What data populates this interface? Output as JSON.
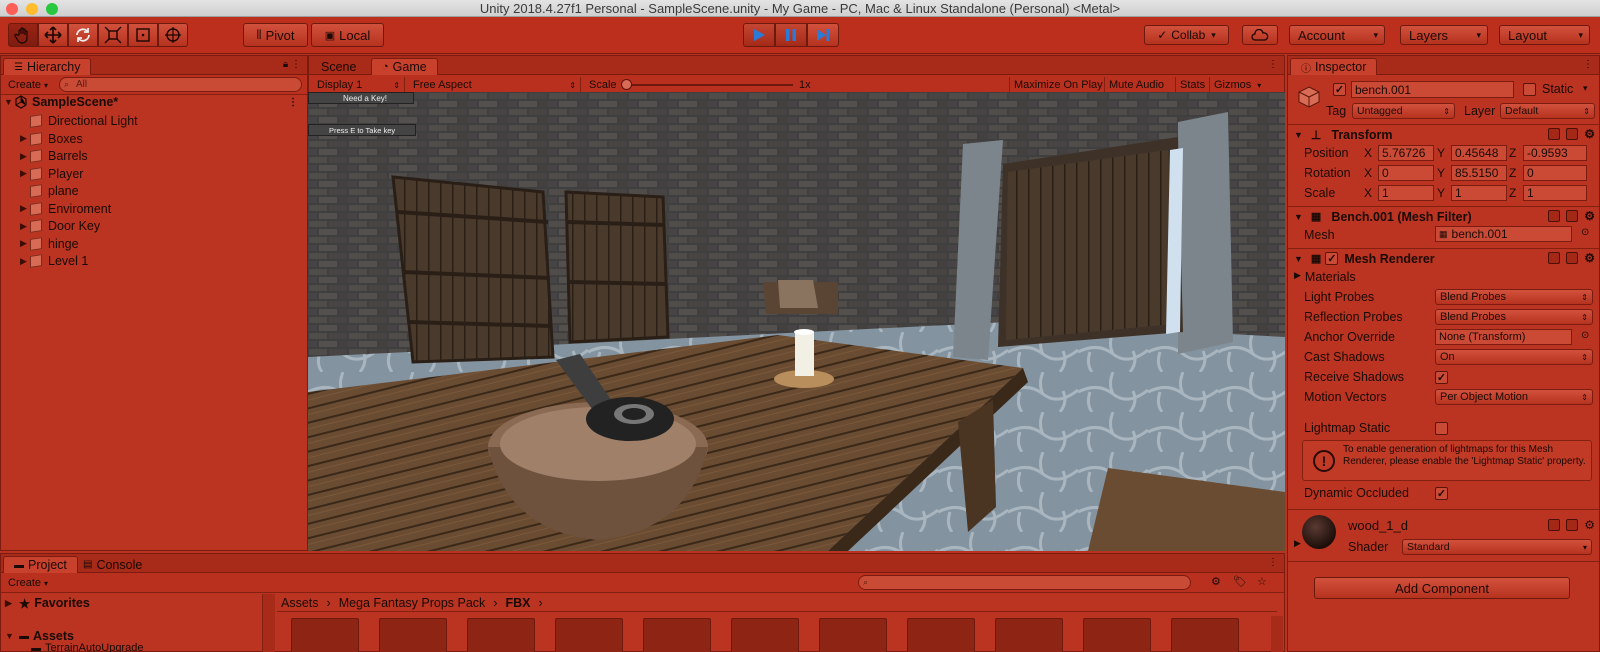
{
  "window": {
    "title": "Unity 2018.4.27f1 Personal - SampleScene.unity - My Game - PC, Mac & Linux Standalone (Personal) <Metal>",
    "traffic_colors": [
      "#ff5f57",
      "#febc2e",
      "#28c840"
    ]
  },
  "toolbar": {
    "tools": [
      "hand-tool-icon",
      "move-tool-icon",
      "rotate-tool-icon",
      "scale-tool-icon",
      "rect-tool-icon",
      "transform-tool-icon"
    ],
    "pivot_label": "Pivot",
    "local_label": "Local",
    "collab_label": "Collab",
    "account_label": "Account",
    "layers_label": "Layers",
    "layout_label": "Layout"
  },
  "hierarchy": {
    "tab_label": "Hierarchy",
    "create_label": "Create",
    "search_placeholder": "All",
    "scene_name": "SampleScene*",
    "items": [
      {
        "label": "Directional Light",
        "has_children": false
      },
      {
        "label": "Boxes",
        "has_children": true
      },
      {
        "label": "Barrels",
        "has_children": true
      },
      {
        "label": "Player",
        "has_children": true
      },
      {
        "label": "plane",
        "has_children": false
      },
      {
        "label": "Enviroment",
        "has_children": true
      },
      {
        "label": "Door Key",
        "has_children": true
      },
      {
        "label": "hinge",
        "has_children": true
      },
      {
        "label": "Level 1",
        "has_children": true
      }
    ]
  },
  "game": {
    "tabs": [
      "Scene",
      "Game"
    ],
    "display_label": "Display 1",
    "aspect_label": "Free Aspect",
    "scale_label": "Scale",
    "scale_value": "1x",
    "toggles": [
      "Maximize On Play",
      "Mute Audio",
      "Stats",
      "Gizmos"
    ],
    "hud_messages": [
      "Need a Key!",
      "Press E to Take key"
    ]
  },
  "inspector": {
    "tab_label": "Inspector",
    "object_name": "bench.001",
    "static_label": "Static",
    "tag_label": "Tag",
    "tag_value": "Untagged",
    "layer_label": "Layer",
    "layer_value": "Default",
    "transform": {
      "title": "Transform",
      "position_label": "Position",
      "rotation_label": "Rotation",
      "scale_label": "Scale",
      "position": {
        "x": "5.76726",
        "y": "0.45648",
        "z": "-0.9593"
      },
      "rotation": {
        "x": "0",
        "y": "85.5150",
        "z": "0"
      },
      "scale": {
        "x": "1",
        "y": "1",
        "z": "1"
      }
    },
    "mesh_filter": {
      "title": "Bench.001 (Mesh Filter)",
      "mesh_label": "Mesh",
      "mesh_value": "bench.001"
    },
    "mesh_renderer": {
      "title": "Mesh Renderer",
      "materials_label": "Materials",
      "light_probes_label": "Light Probes",
      "light_probes_value": "Blend Probes",
      "reflection_probes_label": "Reflection Probes",
      "reflection_probes_value": "Blend Probes",
      "anchor_override_label": "Anchor Override",
      "anchor_override_value": "None (Transform)",
      "cast_shadows_label": "Cast Shadows",
      "cast_shadows_value": "On",
      "receive_shadows_label": "Receive Shadows",
      "motion_vectors_label": "Motion Vectors",
      "motion_vectors_value": "Per Object Motion",
      "lightmap_static_label": "Lightmap Static",
      "lightmap_warning": "To enable generation of lightmaps for this Mesh Renderer, please enable the 'Lightmap Static' property.",
      "dynamic_occluded_label": "Dynamic Occluded"
    },
    "material": {
      "name": "wood_1_d",
      "shader_label": "Shader",
      "shader_value": "Standard"
    },
    "add_component_label": "Add Component"
  },
  "project": {
    "tabs": [
      "Project",
      "Console"
    ],
    "create_label": "Create",
    "favorites_label": "Favorites",
    "assets_label": "Assets",
    "subfolder_label": "TerrainAutoUpgrade",
    "breadcrumb": [
      "Assets",
      "Mega Fantasy Props Pack",
      "FBX"
    ]
  }
}
